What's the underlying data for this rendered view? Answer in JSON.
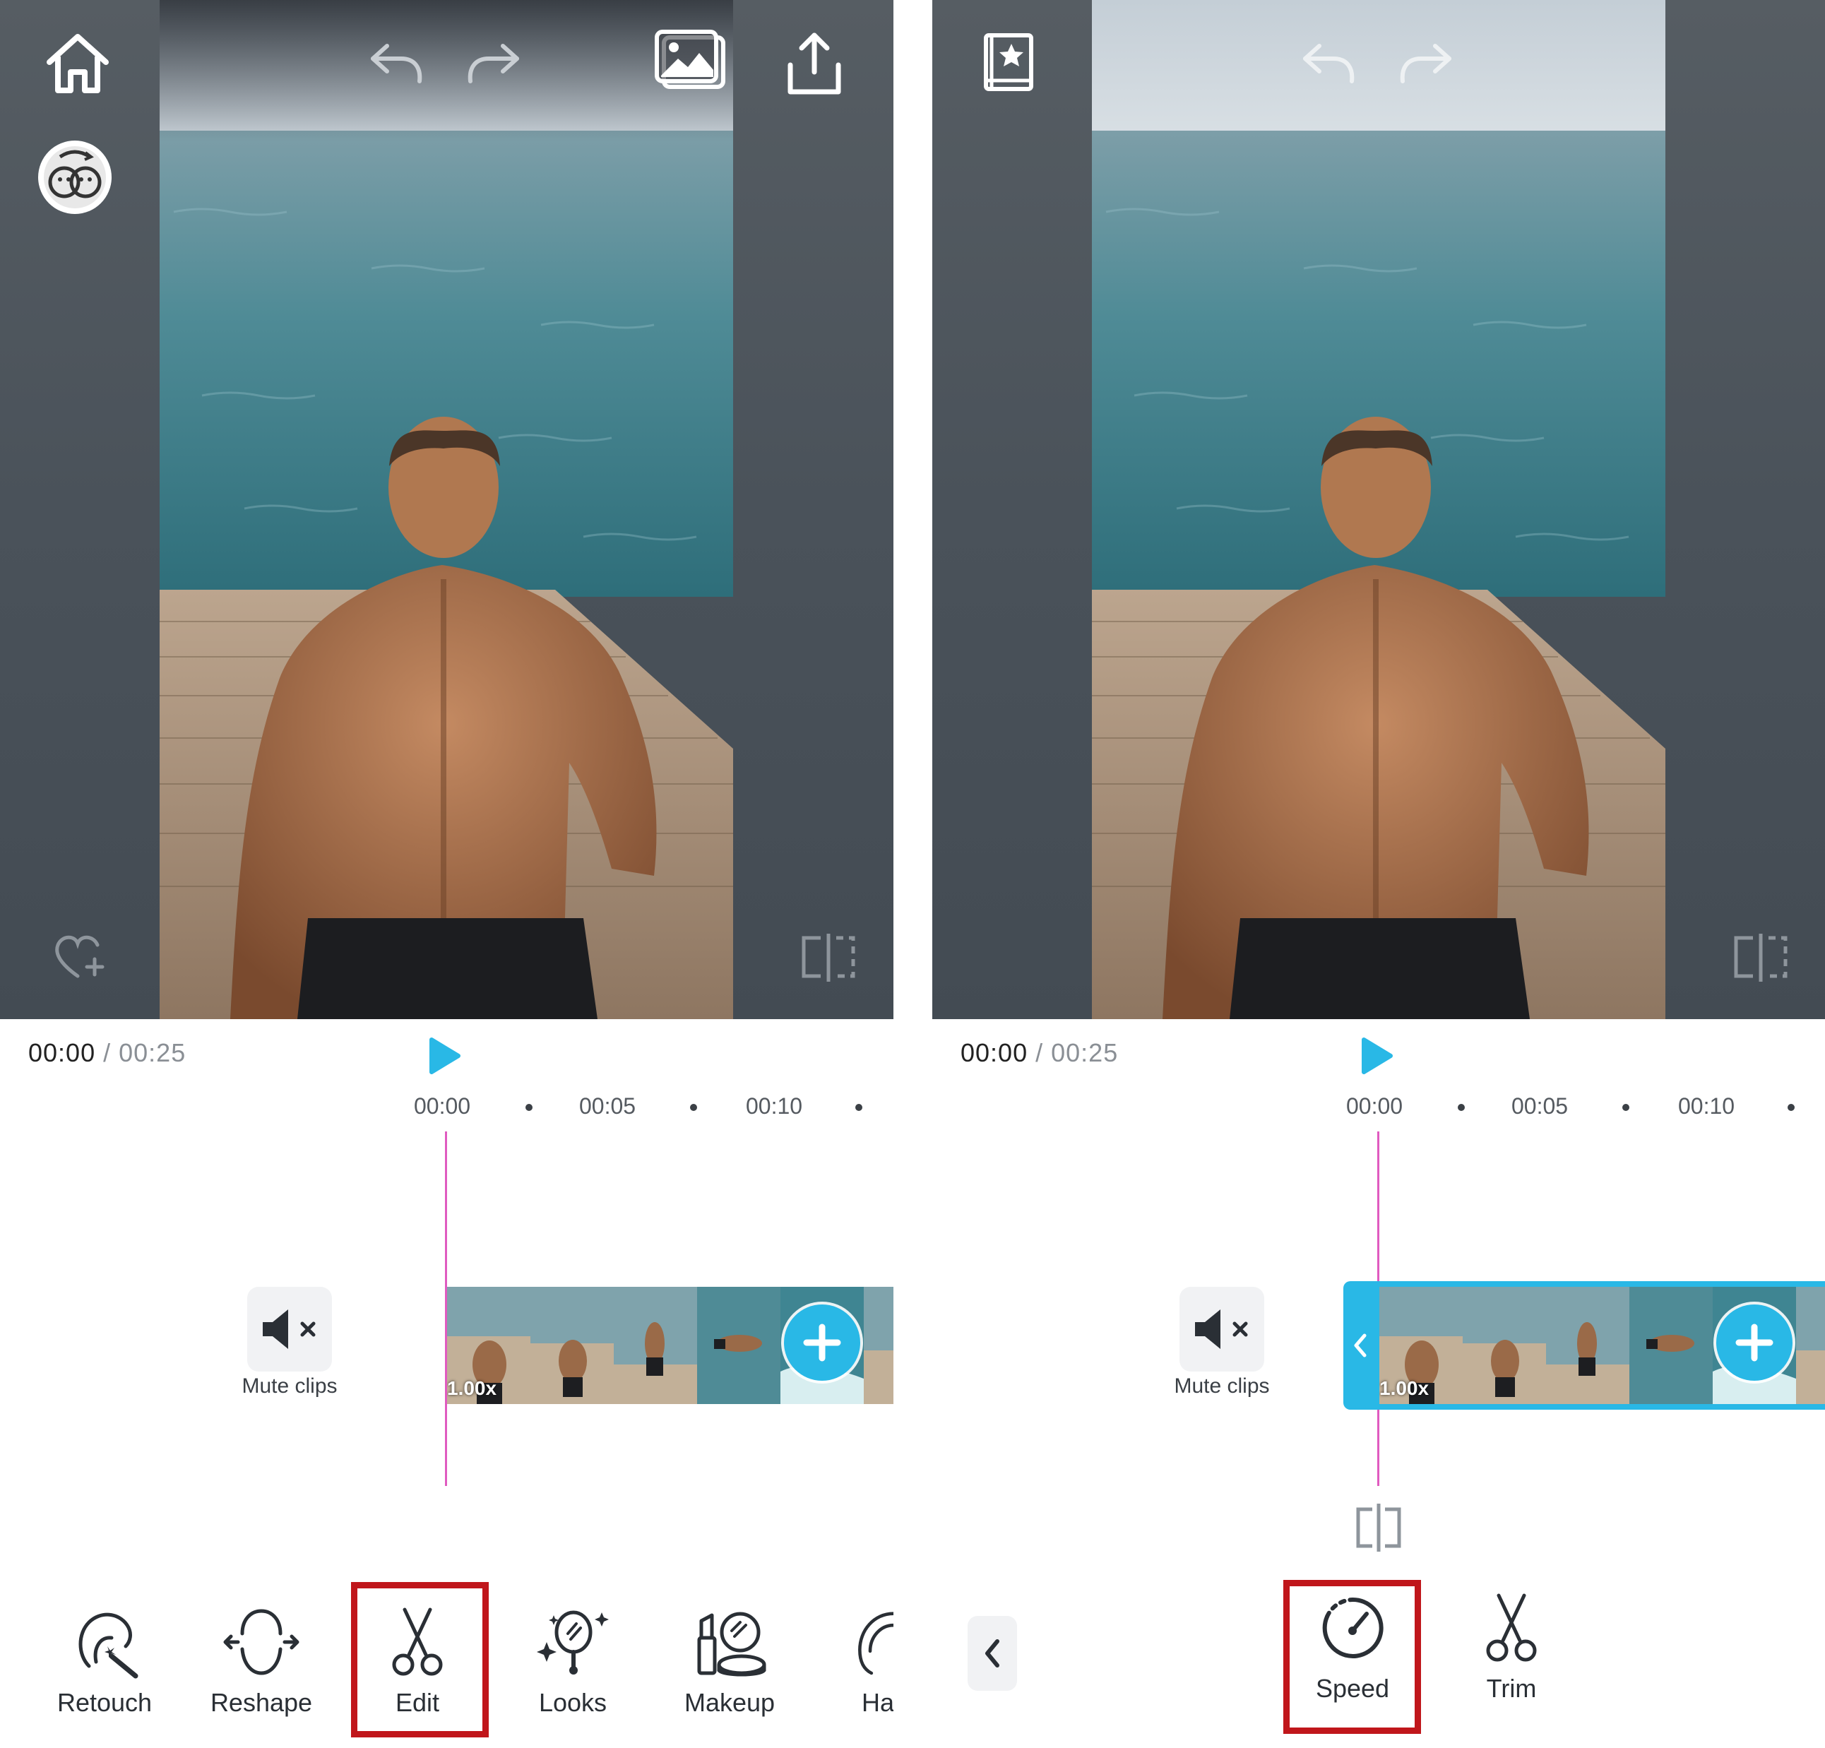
{
  "screens": {
    "left": {
      "time": {
        "current": "00:00",
        "separator": "/",
        "total": "00:25"
      },
      "ruler": {
        "ticks": [
          "00:00",
          "00:05",
          "00:10"
        ]
      },
      "mute": {
        "label": "Mute clips"
      },
      "clip": {
        "speed": "1.00x"
      },
      "toolbar": {
        "items": [
          {
            "label": "Retouch",
            "icon": "retouch-icon"
          },
          {
            "label": "Reshape",
            "icon": "reshape-icon"
          },
          {
            "label": "Edit",
            "icon": "scissors-icon",
            "highlighted": true
          },
          {
            "label": "Looks",
            "icon": "looks-icon"
          },
          {
            "label": "Makeup",
            "icon": "makeup-icon"
          },
          {
            "label": "Ha",
            "icon": "hair-icon"
          }
        ]
      }
    },
    "right": {
      "time": {
        "current": "00:00",
        "separator": "/",
        "total": "00:25"
      },
      "ruler": {
        "ticks": [
          "00:00",
          "00:05",
          "00:10"
        ]
      },
      "mute": {
        "label": "Mute clips"
      },
      "clip": {
        "speed": "1.00x",
        "selected": true
      },
      "toolbar": {
        "items": [
          {
            "label": "Speed",
            "icon": "speed-icon",
            "highlighted": true
          },
          {
            "label": "Trim",
            "icon": "scissors-icon"
          }
        ]
      }
    }
  },
  "colors": {
    "accent": "#29b8e6",
    "playhead": "#e05bc0",
    "highlight": "#c0161b"
  }
}
